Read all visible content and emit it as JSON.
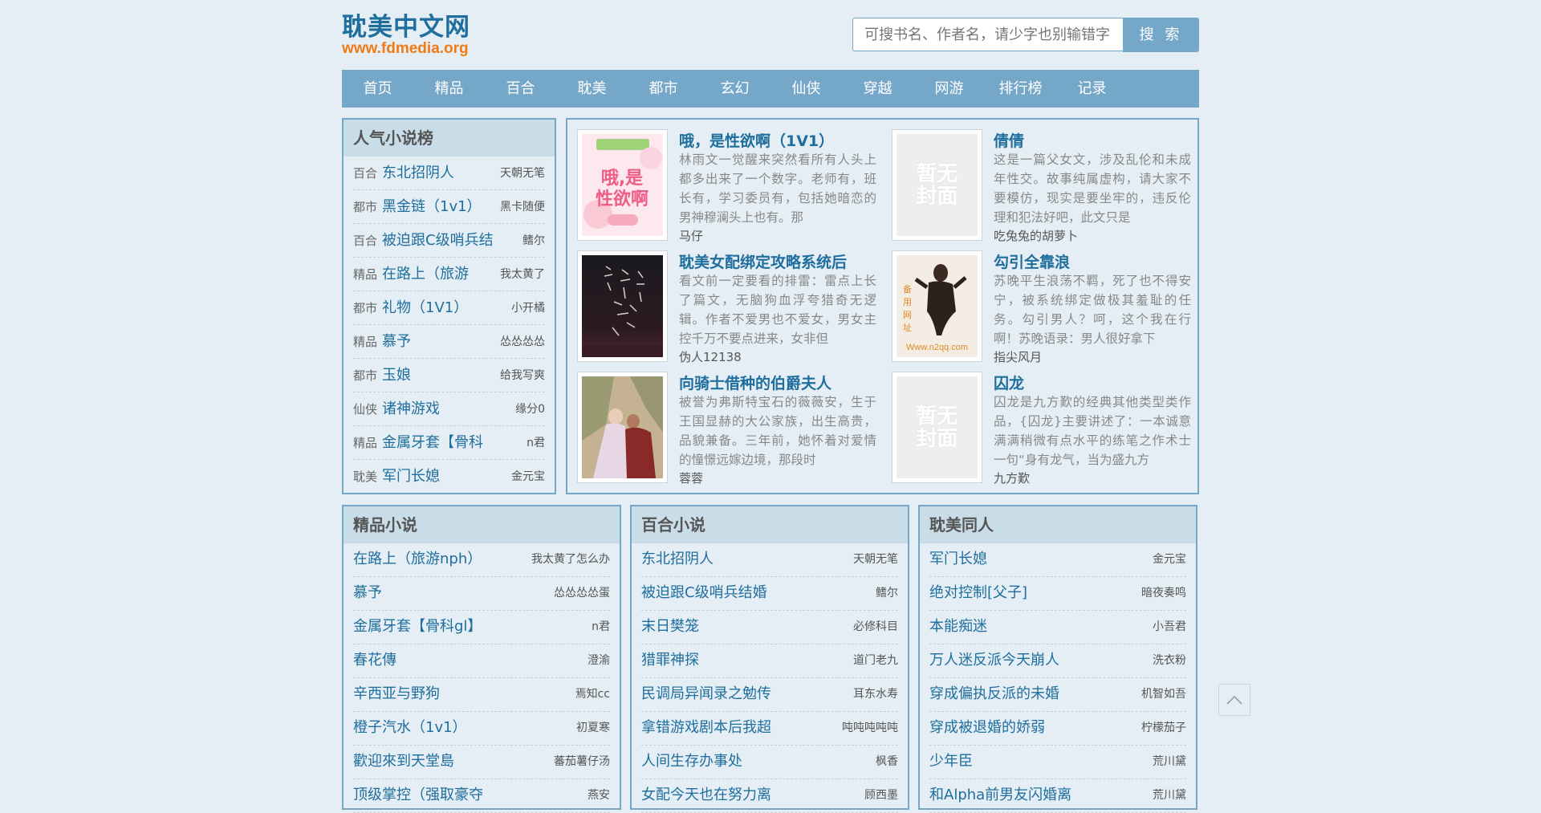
{
  "header": {
    "site_title": "耽美中文网",
    "site_url": "www.fdmedia.org",
    "search_placeholder": "可搜书名、作者名，请少字也别输错字",
    "search_button": "搜 索"
  },
  "nav": [
    "首页",
    "精品",
    "百合",
    "耽美",
    "都市",
    "玄幻",
    "仙侠",
    "穿越",
    "网游",
    "排行榜",
    "记录"
  ],
  "popular": {
    "title": "人气小说榜",
    "items": [
      {
        "cat": "百合",
        "name": "东北招阴人",
        "author": "天朝无笔"
      },
      {
        "cat": "都市",
        "name": "黑金链（1v1）",
        "author": "黑卡随便"
      },
      {
        "cat": "百合",
        "name": "被迫跟C级哨兵结",
        "author": "鳍尔"
      },
      {
        "cat": "精品",
        "name": "在路上（旅游",
        "author": "我太黄了"
      },
      {
        "cat": "都市",
        "name": "礼物（1V1）",
        "author": "小开橘"
      },
      {
        "cat": "精品",
        "name": "慕予",
        "author": "怂怂怂怂"
      },
      {
        "cat": "都市",
        "name": "玉娘",
        "author": "给我写爽"
      },
      {
        "cat": "仙侠",
        "name": "诸神游戏",
        "author": "缘分0"
      },
      {
        "cat": "精品",
        "name": "金属牙套【骨科",
        "author": "n君"
      },
      {
        "cat": "耽美",
        "name": "军门长媳",
        "author": "金元宝"
      }
    ]
  },
  "featured": [
    {
      "title": "哦，是性欲啊（1V1）",
      "desc": "林雨文一觉醒来突然看所有人头上都多出来了一个数字。老师有，班长有，学习委员有，包括她暗恋的男神穆澜头上也有。那",
      "author": "马仔",
      "cover": "pink",
      "cover_text": "哦，是性欲啊"
    },
    {
      "title": "倩倩",
      "desc": "这是一篇父女文，涉及乱伦和未成年性交。故事纯属虚构，请大家不要模仿，现实是要坐牢的，违反伦理和犯法好吧，此文只是",
      "author": "吃兔兔的胡萝卜",
      "cover": "none",
      "cover_text": "暂无封面"
    },
    {
      "title": "耽美女配绑定攻略系统后",
      "desc": "看文前一定要看的排雷：雷点上长了篇文，无脑狗血浮夸猎奇无逻辑。作者不爱男也不爱女，男女主控千万不要点进来，女非但",
      "author": "伪人12138",
      "cover": "dark",
      "cover_text": ""
    },
    {
      "title": "勾引全靠浪",
      "desc": "苏晚平生浪荡不羁，死了也不得安宁，被系统绑定做极其羞耻的任务。勾引男人？呵，这个我在行啊！苏晚语录：男人很好拿下",
      "author": "指尖风月",
      "cover": "figure",
      "cover_text": "Www.n2qq.com"
    },
    {
      "title": "向骑士借种的伯爵夫人",
      "desc": "被誉为弗斯特宝石的薇薇安，生于王国显赫的大公家族，出生高贵，品貌兼备。三年前，她怀着对爱情的憧憬远嫁边境，那段时",
      "author": "蓉蓉",
      "cover": "painting",
      "cover_text": ""
    },
    {
      "title": "囚龙",
      "desc": "囚龙是九方歎的经典其他类型类作品，{囚龙}主要讲述了：一本诚意满满稍微有点水平的练笔之作术士一句“身有龙气，当为盛九方",
      "author": "九方歎",
      "cover": "none",
      "cover_text": "暂无封面"
    }
  ],
  "lists": [
    {
      "title": "精品小说",
      "items": [
        {
          "name": "在路上（旅游nph）",
          "author": "我太黄了怎么办"
        },
        {
          "name": "慕予",
          "author": "怂怂怂怂蛋"
        },
        {
          "name": "金属牙套【骨科gl】",
          "author": "n君"
        },
        {
          "name": "春花傳",
          "author": "澄渝"
        },
        {
          "name": "辛西亚与野狗",
          "author": "焉知cc"
        },
        {
          "name": "橙子汽水（1v1）",
          "author": "初夏寒"
        },
        {
          "name": "歡迎來到天堂島",
          "author": "蕃茄薯仔汤"
        },
        {
          "name": "顶级掌控（强取豪夺",
          "author": "燕安"
        }
      ]
    },
    {
      "title": "百合小说",
      "items": [
        {
          "name": "东北招阴人",
          "author": "天朝无笔"
        },
        {
          "name": "被迫跟C级哨兵结婚",
          "author": "鳍尔"
        },
        {
          "name": "末日樊笼",
          "author": "必修科目"
        },
        {
          "name": "猎罪神探",
          "author": "道门老九"
        },
        {
          "name": "民调局异闻录之勉传",
          "author": "耳东水寿"
        },
        {
          "name": "拿错游戏剧本后我超",
          "author": "吨吨吨吨吨"
        },
        {
          "name": "人间生存办事处",
          "author": "枫香"
        },
        {
          "name": "女配今天也在努力离",
          "author": "顾西墨"
        }
      ]
    },
    {
      "title": "耽美同人",
      "items": [
        {
          "name": "军门长媳",
          "author": "金元宝"
        },
        {
          "name": "绝对控制[父子]",
          "author": "暗夜奏鸣"
        },
        {
          "name": "本能痴迷",
          "author": "小吾君"
        },
        {
          "name": "万人迷反派今天崩人",
          "author": "洗衣粉"
        },
        {
          "name": "穿成偏执反派的未婚",
          "author": "机智如吾"
        },
        {
          "name": "穿成被退婚的娇弱",
          "author": "柠檬茄子"
        },
        {
          "name": "少年臣",
          "author": "荒川黛"
        },
        {
          "name": "和Alpha前男友闪婚离",
          "author": "荒川黛"
        }
      ]
    }
  ],
  "icons": {
    "back_to_top": "chevron-up-icon"
  }
}
